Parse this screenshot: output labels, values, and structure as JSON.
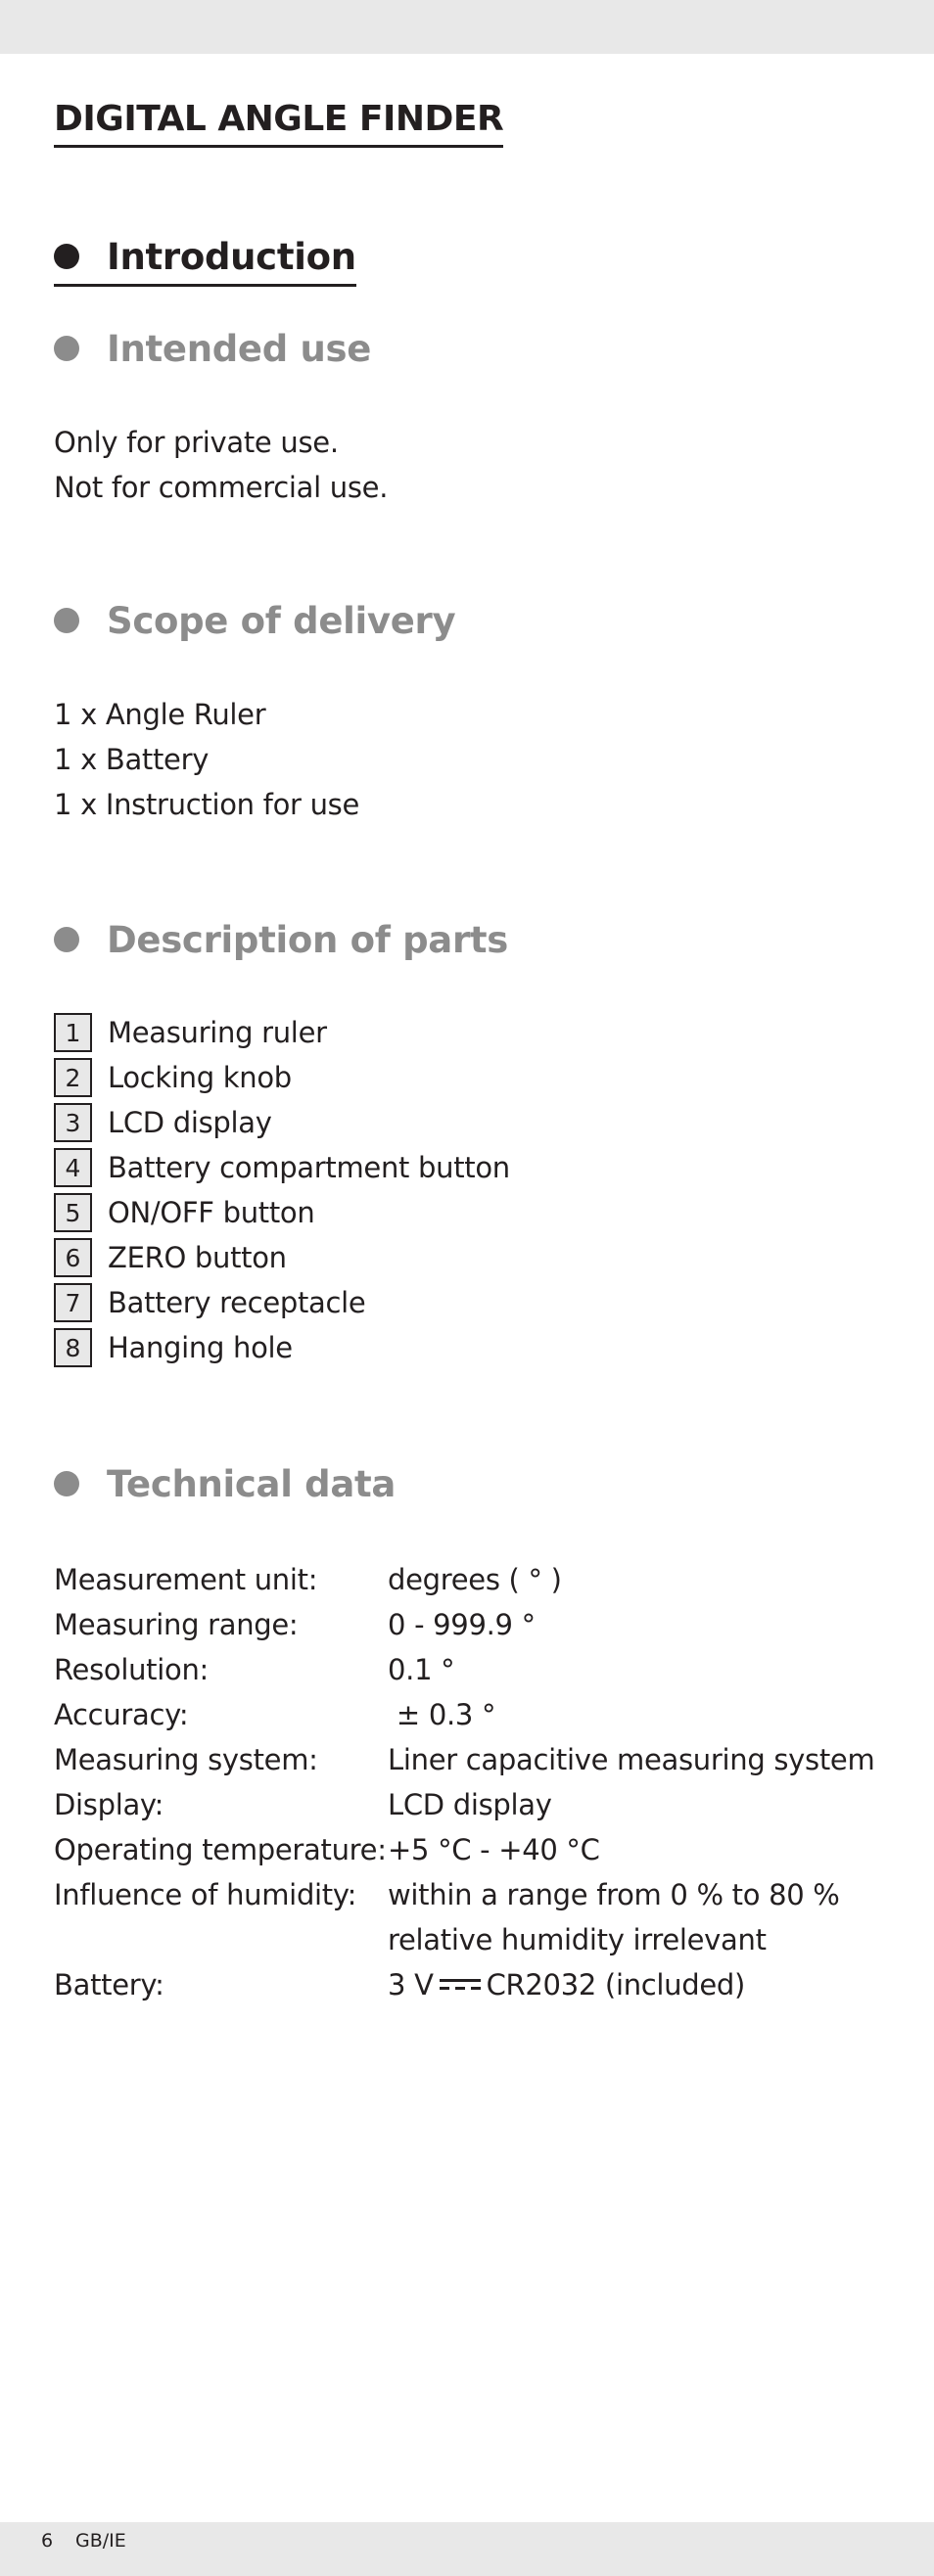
{
  "header": {
    "title": "DIGITAL ANGLE FINDER"
  },
  "sections": {
    "introduction": {
      "heading": "Introduction"
    },
    "intended_use": {
      "heading": "Intended use",
      "lines": [
        "Only for private use.",
        "Not for commercial use."
      ]
    },
    "scope_of_delivery": {
      "heading": "Scope of delivery",
      "items": [
        "1 x Angle Ruler",
        "1 x Battery",
        "1 x Instruction for use"
      ]
    },
    "description_of_parts": {
      "heading": "Description of parts",
      "parts": [
        {
          "number": "1",
          "label": "Measuring ruler"
        },
        {
          "number": "2",
          "label": "Locking knob"
        },
        {
          "number": "3",
          "label": "LCD display"
        },
        {
          "number": "4",
          "label": "Battery compartment button"
        },
        {
          "number": "5",
          "label": "ON/OFF button"
        },
        {
          "number": "6",
          "label": "ZERO button"
        },
        {
          "number": "7",
          "label": "Battery receptacle"
        },
        {
          "number": "8",
          "label": "Hanging hole"
        }
      ]
    },
    "technical_data": {
      "heading": "Technical data",
      "rows": [
        {
          "label": "Measurement unit:",
          "value": "degrees ( ° )"
        },
        {
          "label": "Measuring range:",
          "value": "0 - 999.9 °"
        },
        {
          "label": "Resolution:",
          "value": "0.1 °"
        },
        {
          "label": "Accuracy:",
          "value": " ± 0.3 °"
        },
        {
          "label": "Measuring system:",
          "value": "Liner capacitive measuring system"
        },
        {
          "label": "Display:",
          "value": "LCD display"
        },
        {
          "label": "Operating temperature:",
          "value": "+5 °C - +40 °C"
        },
        {
          "label": "Influence of humidity:",
          "value": "within a range from 0 % to 80 %",
          "value_line2": "relative humidity irrelevant"
        },
        {
          "label": "Battery:",
          "value_prefix": "3 V",
          "value_suffix": "CR2032 (included)",
          "symbol": "dc-current-icon"
        }
      ]
    }
  },
  "footer": {
    "page_number": "6",
    "language": "GB/IE"
  },
  "colors": {
    "text": "#231f20",
    "heading_gray": "#8c8c8c",
    "band": "#e8e8e8"
  }
}
